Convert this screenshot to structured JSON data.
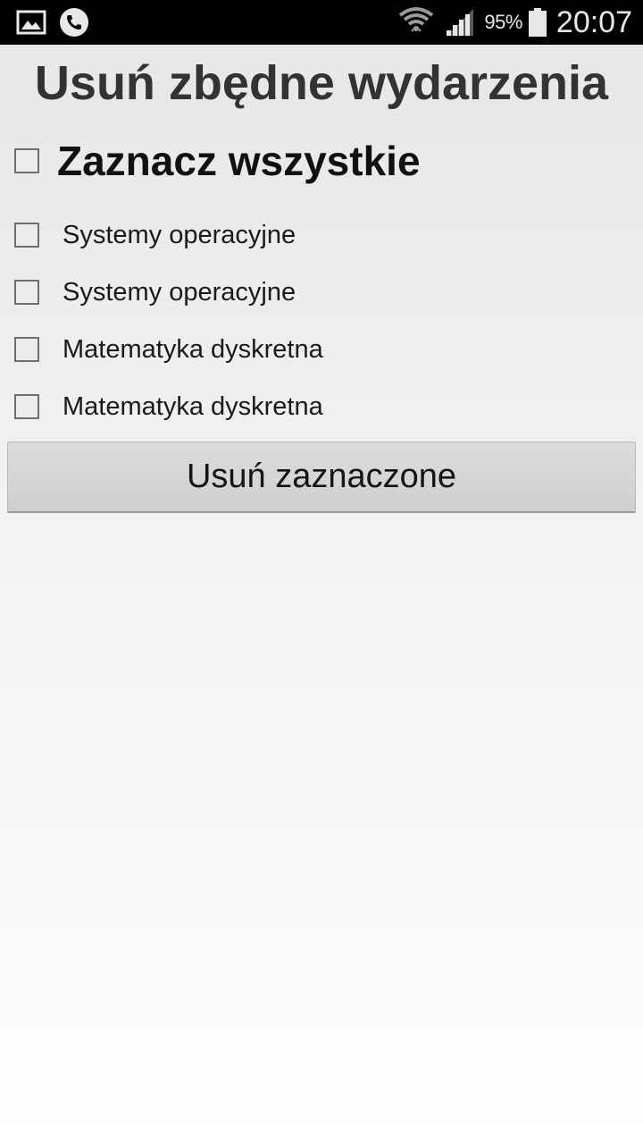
{
  "status_bar": {
    "left_icons": [
      "gallery-notification-icon",
      "phone-call-icon"
    ],
    "right_icons": [
      "wifi-icon",
      "signal-icon",
      "battery-icon"
    ],
    "battery_percent": "95%",
    "time": "20:07"
  },
  "screen": {
    "title": "Usuń zbędne wydarzenia",
    "select_all": {
      "label": "Zaznacz wszystkie",
      "checked": false
    },
    "events": [
      {
        "label": "Systemy operacyjne",
        "checked": false
      },
      {
        "label": "Systemy operacyjne",
        "checked": false
      },
      {
        "label": "Matematyka dyskretna",
        "checked": false
      },
      {
        "label": "Matematyka dyskretna",
        "checked": false
      }
    ],
    "delete_button_label": "Usuń zaznaczone"
  }
}
